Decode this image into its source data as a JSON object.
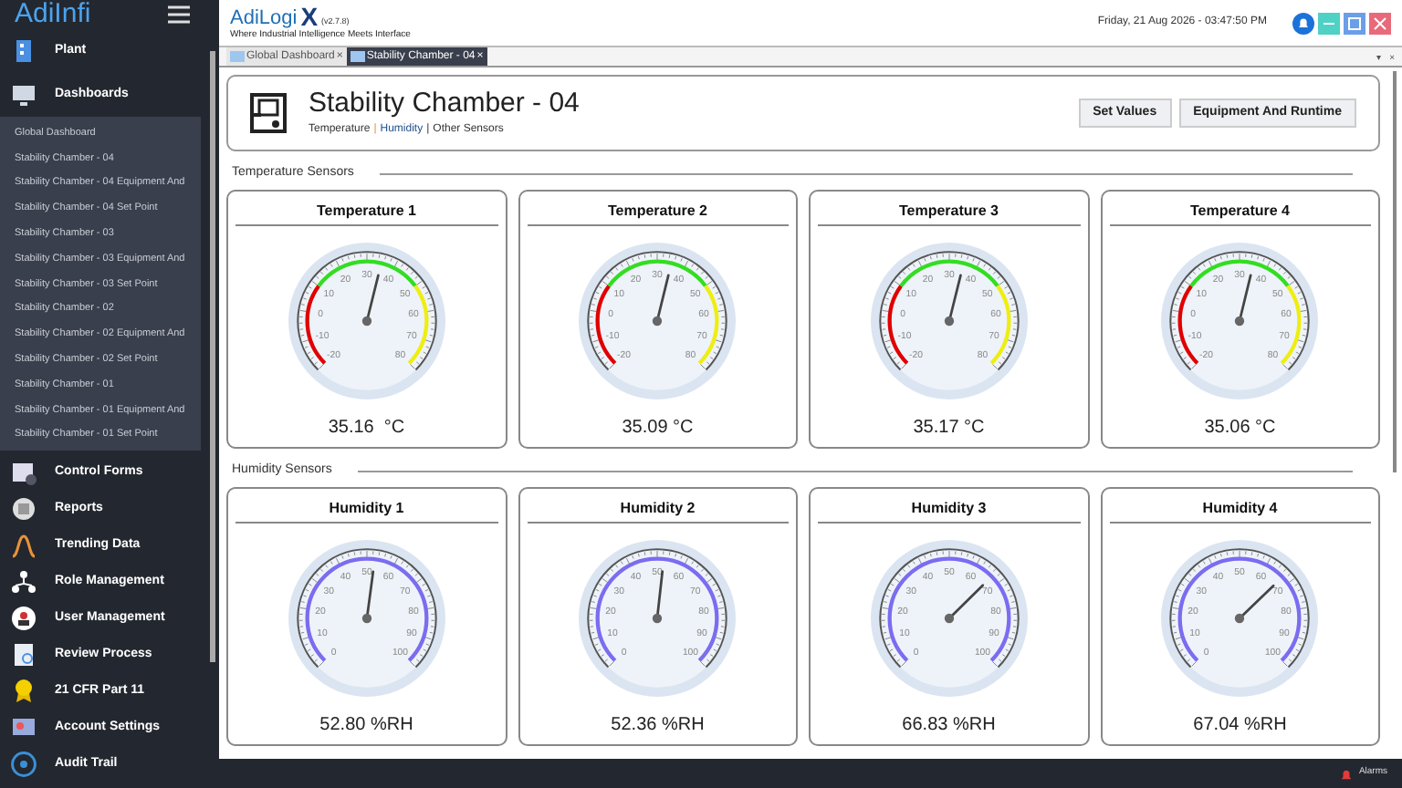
{
  "brand": {
    "logo": "AdiInfi",
    "app_name": "AdiLogi",
    "app_mark": "X",
    "version": "(v2.7.8)",
    "tagline": "Where Industrial Intelligence Meets Interface"
  },
  "header": {
    "datetime": "Friday, 21 Aug 2026 - 03:47:50 PM"
  },
  "sidebar": {
    "items": [
      {
        "label": "Plant",
        "kind": "plant"
      },
      {
        "label": "Dashboards",
        "kind": "monitor",
        "expanded": true,
        "children": [
          {
            "label": "Global Dashboard"
          },
          {
            "label": "Stability Chamber - 04"
          },
          {
            "label": "Stability Chamber - 04 Equipment And"
          },
          {
            "label": "Stability Chamber - 04 Set Point"
          },
          {
            "label": "Stability Chamber - 03"
          },
          {
            "label": "Stability Chamber - 03 Equipment And"
          },
          {
            "label": "Stability Chamber - 03 Set Point"
          },
          {
            "label": "Stability Chamber - 02"
          },
          {
            "label": "Stability Chamber - 02 Equipment And"
          },
          {
            "label": "Stability Chamber - 02 Set Point"
          },
          {
            "label": "Stability Chamber - 01"
          },
          {
            "label": "Stability Chamber - 01 Equipment And"
          },
          {
            "label": "Stability Chamber - 01 Set Point"
          }
        ]
      },
      {
        "label": "Control Forms",
        "kind": "form"
      },
      {
        "label": "Reports",
        "kind": "report"
      },
      {
        "label": "Trending Data",
        "kind": "trend"
      },
      {
        "label": "Role Management",
        "kind": "roles"
      },
      {
        "label": "User Management",
        "kind": "user"
      },
      {
        "label": "Review Process",
        "kind": "review"
      },
      {
        "label": "21 CFR Part 11",
        "kind": "award"
      },
      {
        "label": "Account Settings",
        "kind": "account"
      },
      {
        "label": "Audit Trail",
        "kind": "audit"
      }
    ]
  },
  "tabs": [
    {
      "label": "Global Dashboard",
      "close": "×",
      "selected": false
    },
    {
      "label": "Stability Chamber - 04",
      "close": "×",
      "selected": true
    }
  ],
  "tab_controls": [
    "▾",
    "×"
  ],
  "page": {
    "title": "Stability Chamber - 04",
    "links": [
      "Temperature",
      "Humidity",
      "Other Sensors"
    ],
    "separator": "|",
    "buttons": [
      "Set Values",
      "Equipment And Runtime"
    ]
  },
  "sections": [
    {
      "title": "Temperature Sensors",
      "kind": "temperature",
      "gauges": [
        {
          "title": "Temperature 1",
          "scale": [
            "-20",
            "-10",
            "0",
            "10",
            "20",
            "30",
            "40",
            "50",
            "60",
            "70",
            "80"
          ],
          "reading": "35.16  °C",
          "level": 0.5516
        },
        {
          "title": "Temperature 2",
          "scale": [
            "-20",
            "-10",
            "0",
            "10",
            "20",
            "30",
            "40",
            "50",
            "60",
            "70",
            "80"
          ],
          "reading": "35.09 °C",
          "level": 0.5509
        },
        {
          "title": "Temperature 3",
          "scale": [
            "-20",
            "-10",
            "0",
            "10",
            "20",
            "30",
            "40",
            "50",
            "60",
            "70",
            "80"
          ],
          "reading": "35.17 °C",
          "level": 0.5517
        },
        {
          "title": "Temperature 4",
          "scale": [
            "-20",
            "-10",
            "0",
            "10",
            "20",
            "30",
            "40",
            "50",
            "60",
            "70",
            "80"
          ],
          "reading": "35.06 °C",
          "level": 0.5506
        }
      ]
    },
    {
      "title": "Humidity Sensors",
      "kind": "humidity",
      "gauges": [
        {
          "title": "Humidity 1",
          "scale": [
            "0",
            "10",
            "20",
            "30",
            "40",
            "50",
            "60",
            "70",
            "80",
            "90",
            "100"
          ],
          "reading": "52.80 %RH",
          "level": 0.528
        },
        {
          "title": "Humidity 2",
          "scale": [
            "0",
            "10",
            "20",
            "30",
            "40",
            "50",
            "60",
            "70",
            "80",
            "90",
            "100"
          ],
          "reading": "52.36 %RH",
          "level": 0.5236
        },
        {
          "title": "Humidity 3",
          "scale": [
            "0",
            "10",
            "20",
            "30",
            "40",
            "50",
            "60",
            "70",
            "80",
            "90",
            "100"
          ],
          "reading": "66.83 %RH",
          "level": 0.6683
        },
        {
          "title": "Humidity 4",
          "scale": [
            "0",
            "10",
            "20",
            "30",
            "40",
            "50",
            "60",
            "70",
            "80",
            "90",
            "100"
          ],
          "reading": "67.04 %RH",
          "level": 0.6704
        }
      ]
    }
  ],
  "status_bar": {
    "alarms": "Alarms"
  }
}
